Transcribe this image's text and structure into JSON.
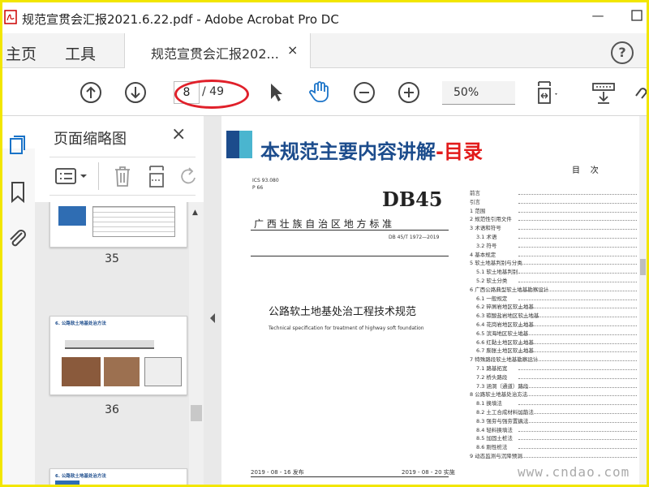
{
  "window": {
    "title": "规范宣贯会汇报2021.6.22.pdf - Adobe Acrobat Pro DC",
    "minimize_glyph": "—"
  },
  "tabs": {
    "home": "主页",
    "tools": "工具",
    "document": "规范宣贯会汇报202...",
    "close_glyph": "×",
    "help_glyph": "?"
  },
  "toolbar": {
    "page_current": "8",
    "page_total": "/ 49",
    "zoom": "50%",
    "icons": [
      "arrow-up-icon",
      "arrow-down-icon",
      "cursor-icon",
      "hand-icon",
      "zoom-out-icon",
      "zoom-in-icon",
      "fit-page-icon",
      "print-icon",
      "link-icon"
    ]
  },
  "leftnav": {
    "icons": [
      "pages-icon",
      "bookmark-icon",
      "attachment-icon"
    ]
  },
  "thumbnails_panel": {
    "title": "页面缩略图",
    "close_glyph": "×",
    "pages": [
      {
        "number": "35"
      },
      {
        "number": "36",
        "heading": "6. 公路软土地基处治方法"
      },
      {
        "heading": "6. 公路软土地基处治方法"
      }
    ]
  },
  "document": {
    "slide_title": "本规范主要内容讲解",
    "slide_title_accent": "-目录",
    "std": {
      "ics": "ICS 93.080",
      "code": "P 66",
      "logo": "DB45",
      "region": "广 西 壮 族 自 治 区 地 方 标 准",
      "number": "DB 45/T 1972—2019",
      "title_cn": "公路软土地基处治工程技术规范",
      "title_en": "Technical specification for treatment of highway soft foundation",
      "issued": "2019 - 08 - 16 发布",
      "effective": "2019 - 08 - 20 实施"
    },
    "toc": {
      "heading": "目    次",
      "rows": [
        "前言",
        "引言",
        "1  范围",
        "2  规范性引用文件",
        "3  术语和符号",
        "3.1  术语",
        "3.2  符号",
        "4  基本规定",
        "5  软土地基判别与分类",
        "5.1  软土地基判别",
        "5.2  软土分类",
        "6  广西公路典型软土地基勘察设计",
        "6.1  一般规定",
        "6.2  碎屑岩地区软土地基",
        "6.3  碳酸盐岩地区软土地基",
        "6.4  花岗岩地区软土地基",
        "6.5  滨海地区软土地基",
        "6.6  红黏土地区软土地基",
        "6.7  膨胀土地区软土地基",
        "7  特殊路段软土地基勘察设计",
        "7.1  路基拓宽",
        "7.2  桥头路段",
        "7.3  涵洞（通道）路段",
        "8  公路软土地基处治方法",
        "8.1  换填法",
        "8.2  土工合成材料加筋法",
        "8.3  强夯与强夯置换法",
        "8.4  轻料换填法",
        "8.5  加固土桩法",
        "8.6  刚性桩法",
        "9  动态监测与沉降预测"
      ]
    }
  },
  "watermark": "www.cndao.com",
  "colors": {
    "accent_blue": "#1c4c8c",
    "accent_red": "#e21b1b",
    "highlight_yellow": "#f2e600",
    "annotation_red": "#e0202a"
  }
}
